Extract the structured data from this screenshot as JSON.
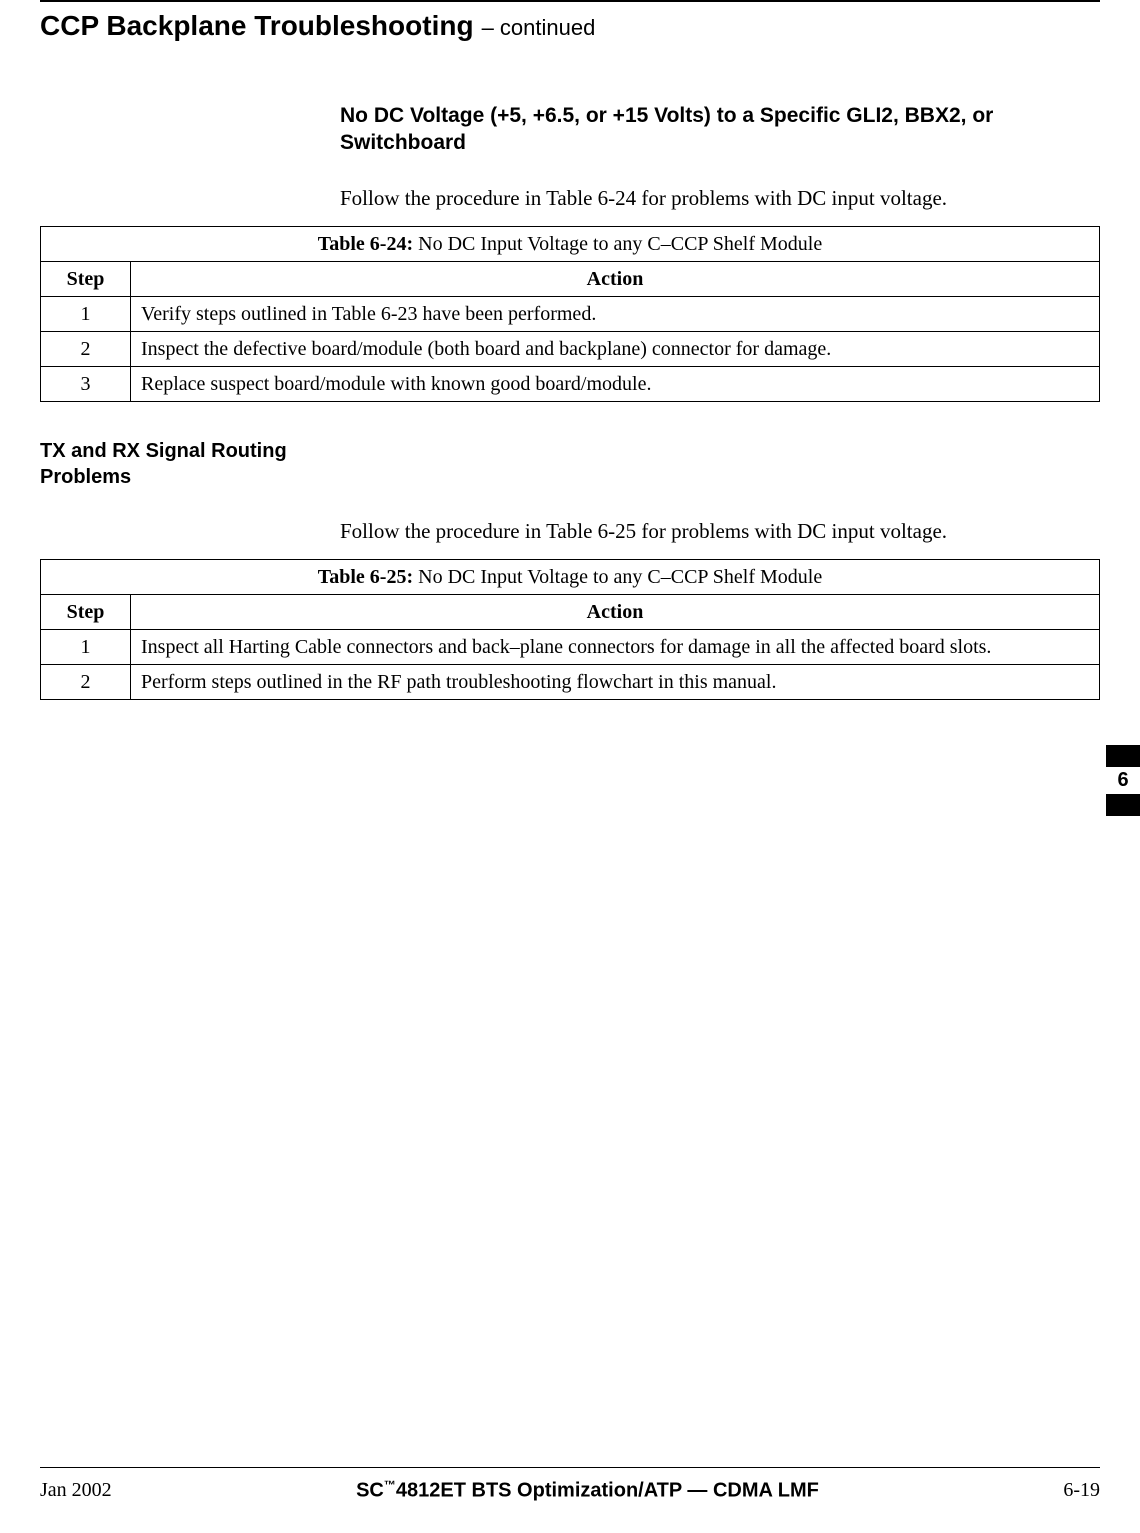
{
  "header": {
    "title": "CCP Backplane Troubleshooting",
    "continued": " – continued"
  },
  "section1": {
    "heading": "No DC Voltage (+5, +6.5, or +15 Volts) to a Specific GLI2, BBX2, or Switchboard",
    "intro": "Follow the procedure in Table 6-24 for problems with DC input voltage."
  },
  "table624": {
    "caption_bold": "Table 6-24:",
    "caption_rest": " No DC Input Voltage to any C–CCP Shelf Module",
    "col_step": "Step",
    "col_action": "Action",
    "rows": [
      {
        "step": "1",
        "action": "Verify steps outlined in Table 6-23 have been performed."
      },
      {
        "step": "2",
        "action": "Inspect the defective board/module (both board and backplane) connector for damage."
      },
      {
        "step": "3",
        "action": "Replace suspect board/module with known good board/module."
      }
    ]
  },
  "section2": {
    "side_heading": "TX and RX Signal Routing Problems",
    "intro": "Follow the procedure in Table 6-25 for problems with DC input voltage."
  },
  "table625": {
    "caption_bold": "Table 6-25:",
    "caption_rest": " No DC Input Voltage to any C–CCP Shelf Module",
    "col_step": "Step",
    "col_action": "Action",
    "rows": [
      {
        "step": "1",
        "action": "Inspect all Harting Cable connectors and back–plane connectors for damage in all the affected board slots."
      },
      {
        "step": "2",
        "action": "Perform steps outlined in the RF path troubleshooting flowchart in this manual."
      }
    ]
  },
  "tab": {
    "num": "6"
  },
  "footer": {
    "left": "Jan 2002",
    "center_prefix": "SC",
    "center_tm": "™",
    "center_suffix": "4812ET BTS Optimization/ATP — CDMA LMF",
    "right": "6-19"
  }
}
